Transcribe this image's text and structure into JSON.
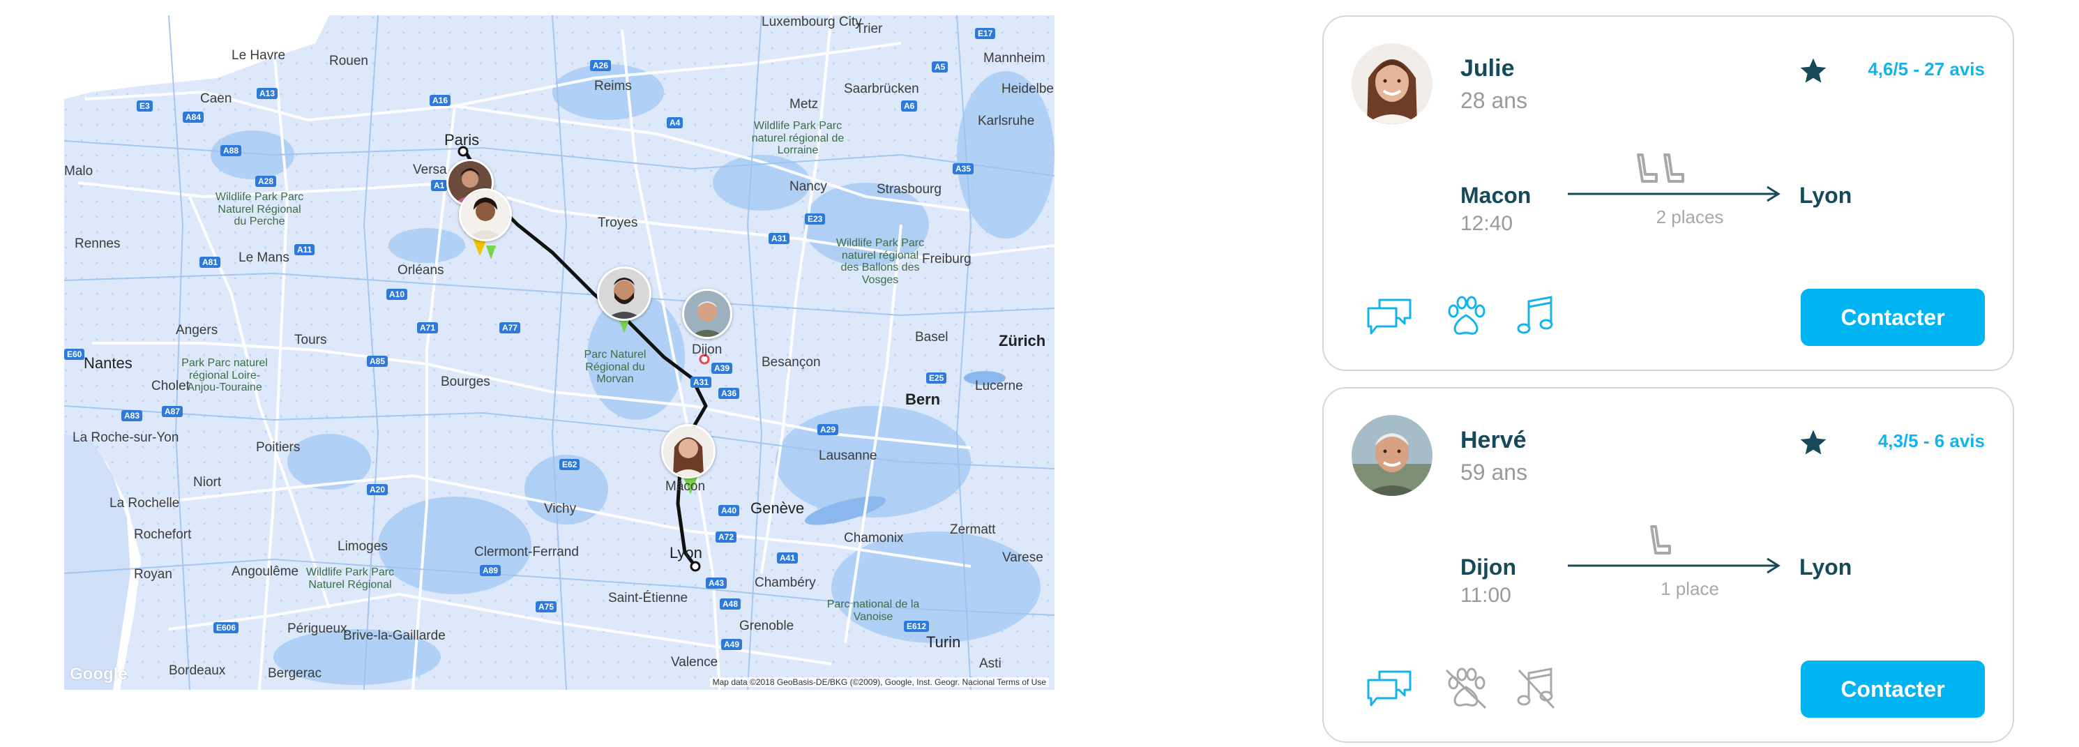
{
  "map": {
    "cities": [
      {
        "name": "Le Havre"
      },
      {
        "name": "Rouen"
      },
      {
        "name": "Caen"
      },
      {
        "name": "Paris"
      },
      {
        "name": "Versa"
      },
      {
        "name": "Reims"
      },
      {
        "name": "Metz"
      },
      {
        "name": "Strasbourg"
      },
      {
        "name": "Nancy"
      },
      {
        "name": "Troyes"
      },
      {
        "name": "Orléans"
      },
      {
        "name": "Le Mans"
      },
      {
        "name": "Rennes"
      },
      {
        "name": "Angers"
      },
      {
        "name": "Tours"
      },
      {
        "name": "Nantes"
      },
      {
        "name": "Cholet"
      },
      {
        "name": "Bourges"
      },
      {
        "name": "Poitiers"
      },
      {
        "name": "Niort"
      },
      {
        "name": "La Rochelle"
      },
      {
        "name": "Rochefort"
      },
      {
        "name": "Royan"
      },
      {
        "name": "Angoulême"
      },
      {
        "name": "Limoges"
      },
      {
        "name": "Vichy"
      },
      {
        "name": "Clermont-Ferrand"
      },
      {
        "name": "Lyon"
      },
      {
        "name": "Saint-Étienne"
      },
      {
        "name": "Grenoble"
      },
      {
        "name": "Chambéry"
      },
      {
        "name": "Valence"
      },
      {
        "name": "Dijon"
      },
      {
        "name": "Besançon"
      },
      {
        "name": "Mâcon"
      },
      {
        "name": "Genève"
      },
      {
        "name": "Lausanne"
      },
      {
        "name": "Bern"
      },
      {
        "name": "Basel"
      },
      {
        "name": "Zürich"
      },
      {
        "name": "Lucerne"
      },
      {
        "name": "Freiburg"
      },
      {
        "name": "Karlsruhe"
      },
      {
        "name": "Mannheim"
      },
      {
        "name": "Heidelber"
      },
      {
        "name": "Saarbrücken"
      },
      {
        "name": "Trier"
      },
      {
        "name": "Luxembourg City"
      },
      {
        "name": "Turin"
      },
      {
        "name": "Asti"
      },
      {
        "name": "Bordeaux"
      },
      {
        "name": "Bergerac"
      },
      {
        "name": "Périgueux"
      },
      {
        "name": "Brive-la-Gaillarde"
      },
      {
        "name": "Malo"
      },
      {
        "name": "La Roche-sur-Yon"
      },
      {
        "name": "Chamonix"
      },
      {
        "name": "Zermatt"
      },
      {
        "name": "Varese"
      }
    ],
    "parks": [
      {
        "name": "Wildlife Park Parc Naturel Régional du Perche"
      },
      {
        "name": "Parc Naturel Régional du Morvan"
      },
      {
        "name": "Park Parc naturel régional Loire-Anjou-Touraine"
      },
      {
        "name": "Wildlife Park Parc naturel régional de Lorraine"
      },
      {
        "name": "Wildlife Park Parc naturel régional des Ballons des Vosges"
      },
      {
        "name": "Wildlife Park Parc Naturel Régional"
      },
      {
        "name": "Parc national de la Vanoise"
      }
    ],
    "shields": [
      "E3",
      "A84",
      "A88",
      "A13",
      "A16",
      "A28",
      "A26",
      "A4",
      "A31",
      "E23",
      "A11",
      "A81",
      "A10",
      "A71",
      "A77",
      "A85",
      "A87",
      "A83",
      "E62",
      "A20",
      "A89",
      "A75",
      "A72",
      "A43",
      "A41",
      "A40",
      "A39",
      "A36",
      "A31",
      "E25",
      "A35",
      "E606",
      "A49",
      "A48",
      "E612",
      "A6",
      "A5",
      "E17",
      "A1",
      "A29",
      "E60"
    ],
    "footer": "Map data ©2018 GeoBasis-DE/BKG (©2009), Google, Inst. Geogr. Nacional    Terms of Use",
    "logo": "Google"
  },
  "cards": [
    {
      "name": "Julie",
      "age": "28 ans",
      "rating": "4,6/5 - 27 avis",
      "from_city": "Macon",
      "from_time": "12:40",
      "places": "2 places",
      "to_city": "Lyon",
      "button_label": "Contacter",
      "features": {
        "chat": true,
        "pets": true,
        "music": true
      }
    },
    {
      "name": "Hervé",
      "age": "59 ans",
      "rating": "4,3/5 - 6 avis",
      "from_city": "Dijon",
      "from_time": "11:00",
      "places": "1 place",
      "to_city": "Lyon",
      "button_label": "Contacter",
      "features": {
        "chat": true,
        "pets": false,
        "music": false
      }
    }
  ],
  "colors": {
    "accent": "#00b4f1",
    "dark_text": "#164a5a",
    "muted_text": "#9a9a9a",
    "rating": "#14b3ea",
    "map_water": "#a9cbf3",
    "map_land": "#dbe8fb",
    "route": "#111111"
  }
}
